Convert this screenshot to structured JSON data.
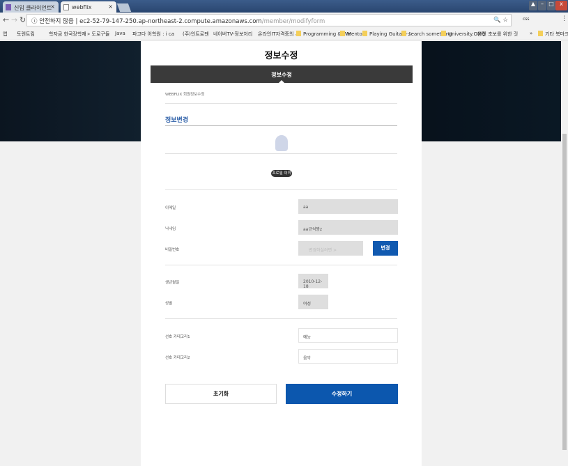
{
  "browser": {
    "tabs": [
      {
        "label": "신입 클라이언트 프로그"
      },
      {
        "label": "webflix"
      }
    ],
    "address_secure": "안전하지 않음",
    "address_host": "ec2-52-79-147-250.ap-northeast-2.compute.amazonaws.com",
    "address_path": "/member/modifyform",
    "extensions": [
      "css"
    ],
    "bookmarks": [
      "앱",
      "토렌트킴",
      "학자금 한국장학재",
      "» 도로구들",
      "Java",
      "파고다 어학원 : i ca",
      "(주)인트로맨",
      "네이버TV-정보처리",
      "온라인IT자격증의 시",
      "Programming & We",
      "Mento.",
      "Playing Guitar~♪",
      "search something",
      "University.OMG",
      "완전 초보를 위한 것",
      "»",
      "기타 북마크"
    ]
  },
  "page": {
    "title": "정보수정",
    "tab_bar": "정보수정",
    "breadcrumb": "WEBFLIX 회원정보수정",
    "section": "정보변경",
    "profile_button": "프로필 이미지"
  },
  "form": {
    "email": {
      "label": "이메일",
      "value": "aa"
    },
    "nickname": {
      "label": "닉네임",
      "value": "aa규석짱z"
    },
    "password": {
      "label": "비밀번호",
      "value": "변경하실려면 >",
      "button": "변경"
    },
    "birth": {
      "label": "생년월일",
      "value": "2010-12-18"
    },
    "gender": {
      "label": "성별",
      "value": "여성"
    },
    "cat1": {
      "label": "선호 카테고리1",
      "value": "예능"
    },
    "cat2": {
      "label": "선호 카테고리2",
      "value": "음악"
    },
    "reset": "초기화",
    "submit": "수정하기"
  },
  "colors": {
    "accent": "#0c57ae",
    "bar": "#3a3a3a"
  }
}
